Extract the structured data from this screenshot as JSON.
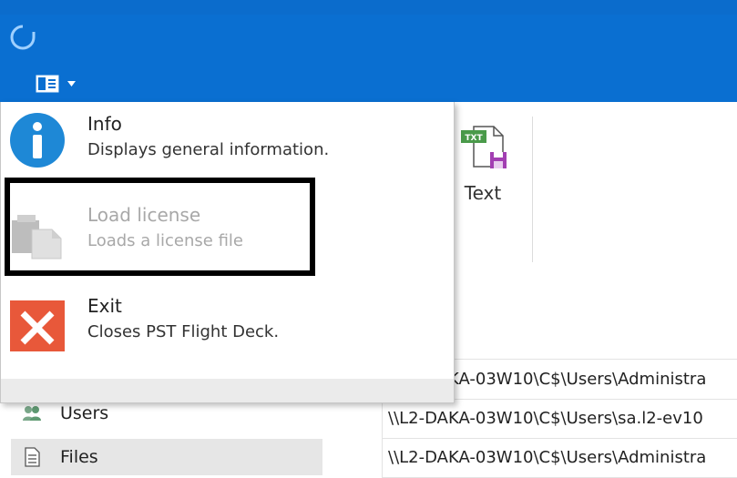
{
  "menu": {
    "items": [
      {
        "title": "Info",
        "description": "Displays general information.",
        "icon": "info-icon",
        "enabled": true
      },
      {
        "title": "Load license",
        "description": "Loads a license file",
        "icon": "license-file-icon",
        "enabled": false
      },
      {
        "title": "Exit",
        "description": "Closes PST Flight Deck.",
        "icon": "exit-icon",
        "enabled": true
      }
    ]
  },
  "ribbon": {
    "text_button_label": "Text",
    "text_icon_badge": "TXT"
  },
  "nav": {
    "items": [
      {
        "label": "Users",
        "icon": "users-icon"
      },
      {
        "label": "Files",
        "icon": "files-icon",
        "selected": true
      }
    ]
  },
  "paths": [
    "KA-03W10\\C$\\Users\\Administra",
    "\\\\L2-DAKA-03W10\\C$\\Users\\sa.l2-ev10",
    "\\\\L2-DAKA-03W10\\C$\\Users\\Administra"
  ],
  "colors": {
    "accent": "#0a6fd1",
    "exit": "#e8583a",
    "info": "#1e88d6",
    "highlight": "#000000"
  }
}
